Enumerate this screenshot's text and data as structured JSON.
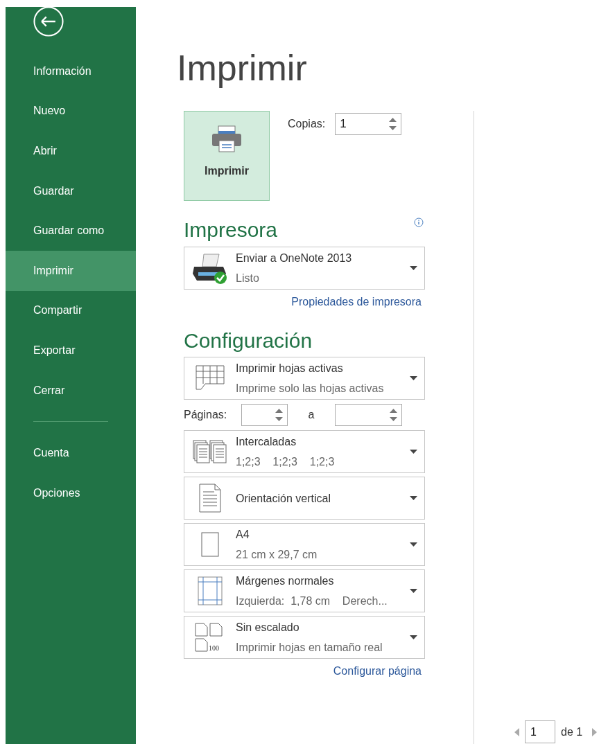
{
  "sidebar": {
    "items": [
      {
        "label": "Información",
        "selected": false
      },
      {
        "label": "Nuevo",
        "selected": false
      },
      {
        "label": "Abrir",
        "selected": false
      },
      {
        "label": "Guardar",
        "selected": false
      },
      {
        "label": "Guardar como",
        "selected": false
      },
      {
        "label": "Imprimir",
        "selected": true
      },
      {
        "label": "Compartir",
        "selected": false
      },
      {
        "label": "Exportar",
        "selected": false
      },
      {
        "label": "Cerrar",
        "selected": false
      }
    ],
    "footer_items": [
      {
        "label": "Cuenta",
        "selected": false
      },
      {
        "label": "Opciones",
        "selected": false
      }
    ]
  },
  "page": {
    "title": "Imprimir",
    "print_button": {
      "label": "Imprimir"
    },
    "copies": {
      "label": "Copias:",
      "value": "1"
    },
    "printer_section": {
      "heading": "Impresora",
      "device": {
        "kind": "printer",
        "title": "Enviar a OneNote 2013",
        "subtitle": "Listo"
      },
      "link": "Propiedades de impresora"
    },
    "settings_section": {
      "heading": "Configuración",
      "items": [
        {
          "kind": "sheets",
          "title": "Imprimir hojas activas",
          "subtitle": "Imprime solo las hojas activas"
        },
        {
          "kind": "page_range",
          "label": "Páginas:",
          "separator": "a"
        },
        {
          "kind": "collate",
          "title": "Intercaladas",
          "subtitle": "1;2;3    1;2;3    1;2;3"
        },
        {
          "kind": "portrait",
          "title": "Orientación vertical"
        },
        {
          "kind": "paper",
          "title": "A4",
          "subtitle": "21 cm x 29,7 cm"
        },
        {
          "kind": "margins",
          "title": "Márgenes normales",
          "subtitle": "Izquierda:  1,78 cm    Derech..."
        },
        {
          "kind": "scaling",
          "title": "Sin escalado",
          "subtitle": "Imprimir hojas en tamaño real",
          "badge": "100"
        }
      ],
      "link": "Configurar página"
    }
  },
  "preview": {
    "pager": {
      "value": "1",
      "total": "de 1"
    }
  }
}
